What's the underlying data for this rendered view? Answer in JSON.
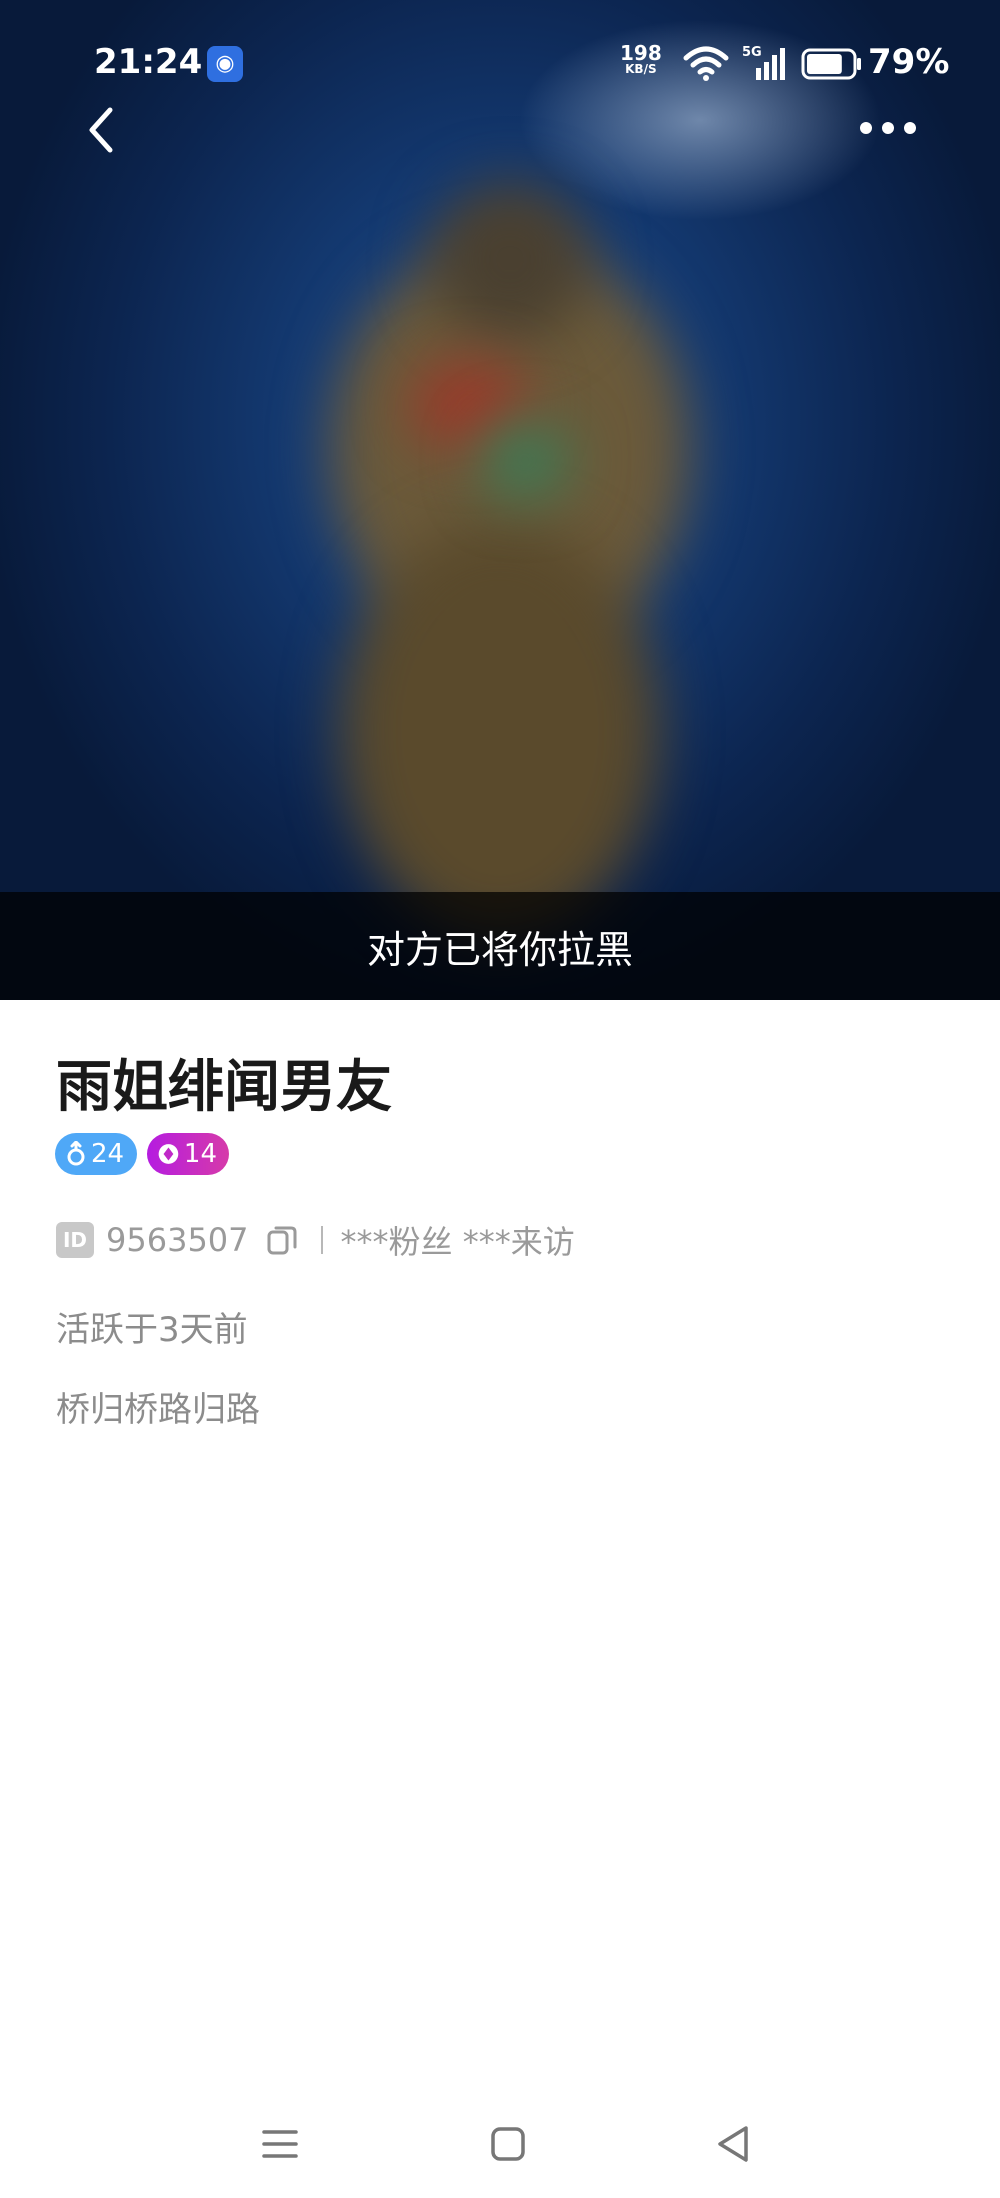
{
  "status_bar": {
    "time": "21:24",
    "net_speed_value": "198",
    "net_speed_unit": "KB/S",
    "network": "5G",
    "battery": "79%",
    "battery_level": 0.79,
    "app_icon": "browser-app-icon"
  },
  "header": {
    "back_icon": "chevron-left-icon",
    "more_icon": "more-dots-icon"
  },
  "hero": {
    "blocked_message": "对方已将你拉黑"
  },
  "profile": {
    "name": "雨姐绯闻男友",
    "gender_badge": "24",
    "gender_icon": "male-icon",
    "level_badge": "14",
    "level_icon": "diamond-icon",
    "id_label": "ID",
    "id_value": "9563507",
    "stats": "***粉丝 ***来访",
    "active": "活跃于3天前",
    "bio": "桥归桥路归路"
  },
  "nav": {
    "menu_icon": "menu-icon",
    "home_icon": "home-square-icon",
    "back_icon": "back-triangle-icon"
  },
  "colors": {
    "gender_badge": "#4fa8f7",
    "level_badge": "#c028c8",
    "hero_bg": "#143a72"
  }
}
